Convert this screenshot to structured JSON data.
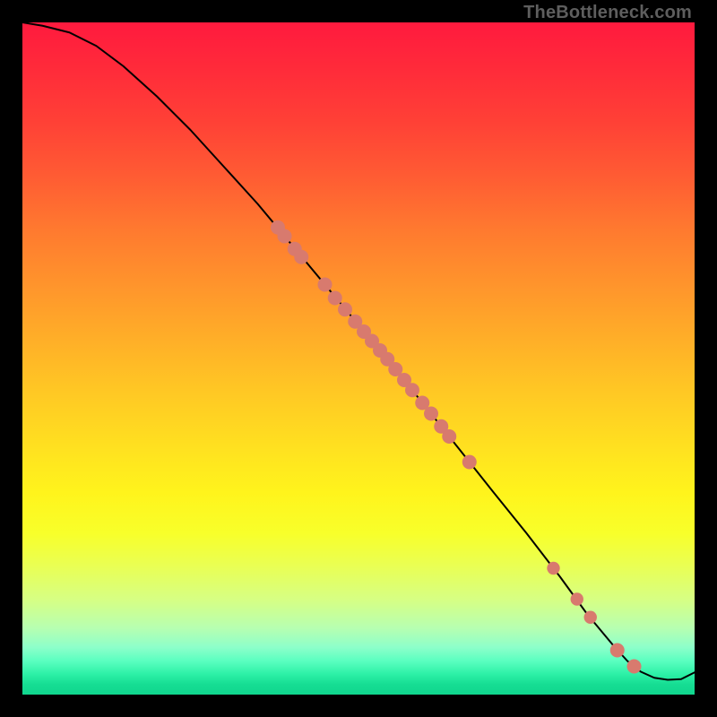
{
  "watermark": "TheBottleneck.com",
  "colors": {
    "dot": "#d87a6e",
    "line": "#000000",
    "frame": "#000000"
  },
  "chart_data": {
    "type": "line",
    "title": "",
    "xlabel": "",
    "ylabel": "",
    "xlim": [
      0,
      100
    ],
    "ylim": [
      0,
      100
    ],
    "grid": false,
    "series": [
      {
        "name": "curve",
        "x": [
          0,
          3,
          7,
          11,
          15,
          20,
          25,
          30,
          35,
          40,
          45,
          50,
          55,
          60,
          65,
          70,
          75,
          80,
          84,
          88,
          90,
          92,
          94,
          96,
          98,
          100
        ],
        "y": [
          100,
          99.5,
          98.5,
          96.5,
          93.5,
          89,
          84,
          78.5,
          73,
          67,
          61,
          55,
          49,
          42.8,
          36.5,
          30.2,
          24,
          17.5,
          12,
          7.2,
          5.0,
          3.4,
          2.5,
          2.2,
          2.3,
          3.3
        ]
      }
    ],
    "points": [
      {
        "x": 38.0,
        "y": 69.5,
        "r": 1.0
      },
      {
        "x": 39.0,
        "y": 68.2,
        "r": 1.0
      },
      {
        "x": 40.5,
        "y": 66.3,
        "r": 1.0
      },
      {
        "x": 41.5,
        "y": 65.1,
        "r": 1.0
      },
      {
        "x": 45.0,
        "y": 61.0,
        "r": 1.0
      },
      {
        "x": 46.5,
        "y": 59.0,
        "r": 1.0
      },
      {
        "x": 48.0,
        "y": 57.3,
        "r": 1.0
      },
      {
        "x": 49.5,
        "y": 55.5,
        "r": 1.0
      },
      {
        "x": 50.8,
        "y": 54.0,
        "r": 1.0
      },
      {
        "x": 52.0,
        "y": 52.6,
        "r": 1.0
      },
      {
        "x": 53.2,
        "y": 51.2,
        "r": 1.0
      },
      {
        "x": 54.3,
        "y": 49.9,
        "r": 1.0
      },
      {
        "x": 55.5,
        "y": 48.4,
        "r": 1.0
      },
      {
        "x": 56.8,
        "y": 46.8,
        "r": 1.0
      },
      {
        "x": 58.0,
        "y": 45.3,
        "r": 1.0
      },
      {
        "x": 59.5,
        "y": 43.4,
        "r": 1.0
      },
      {
        "x": 60.8,
        "y": 41.8,
        "r": 1.0
      },
      {
        "x": 62.3,
        "y": 39.9,
        "r": 1.0
      },
      {
        "x": 63.5,
        "y": 38.4,
        "r": 1.0
      },
      {
        "x": 66.5,
        "y": 34.6,
        "r": 1.0
      },
      {
        "x": 79.0,
        "y": 18.8,
        "r": 0.9
      },
      {
        "x": 82.5,
        "y": 14.2,
        "r": 0.9
      },
      {
        "x": 84.5,
        "y": 11.5,
        "r": 0.9
      },
      {
        "x": 88.5,
        "y": 6.6,
        "r": 1.0
      },
      {
        "x": 91.0,
        "y": 4.2,
        "r": 1.0
      }
    ]
  }
}
